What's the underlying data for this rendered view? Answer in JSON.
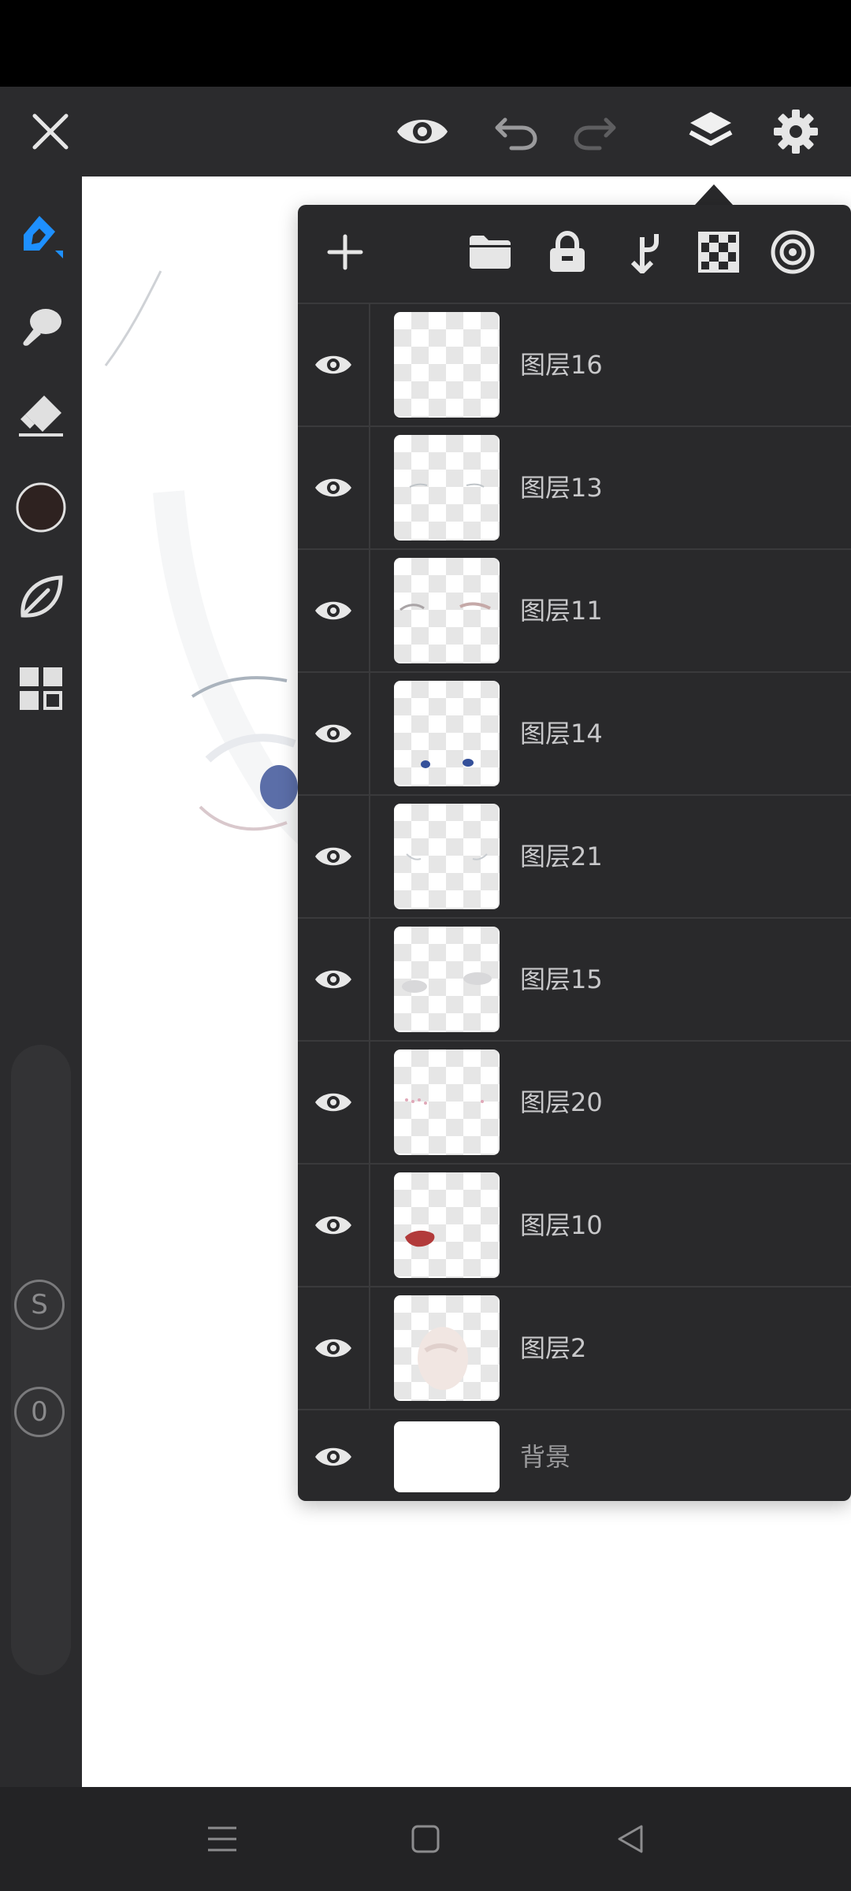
{
  "app": {
    "top_toolbar": {
      "close_icon": "close-icon",
      "preview_icon": "eye-icon",
      "undo_icon": "undo-icon",
      "redo_icon": "redo-icon",
      "layers_icon": "layers-icon",
      "settings_icon": "gear-icon"
    },
    "left_toolbar": {
      "tools": [
        "pen-icon",
        "smudge-icon",
        "eraser-icon",
        "color-swatch",
        "leaf-brush-icon",
        "grid-icon"
      ],
      "current_color": "#2e2220",
      "accent_color": "#1e90ff",
      "indicator_s": "S",
      "indicator_zero": "0"
    },
    "layers_panel": {
      "header_actions": [
        "add-icon",
        "folder-icon",
        "lock-icon",
        "merge-down-icon",
        "transparency-icon",
        "blend-icon"
      ],
      "layers": [
        {
          "name": "图层16",
          "visible": true
        },
        {
          "name": "图层13",
          "visible": true
        },
        {
          "name": "图层11",
          "visible": true
        },
        {
          "name": "图层14",
          "visible": true
        },
        {
          "name": "图层21",
          "visible": true
        },
        {
          "name": "图层15",
          "visible": true
        },
        {
          "name": "图层20",
          "visible": true
        },
        {
          "name": "图层10",
          "visible": true
        },
        {
          "name": "图层2",
          "visible": true
        }
      ],
      "background_layer": {
        "name": "背景",
        "visible": true
      }
    },
    "nav_bar": {
      "menu_icon": "menu-icon",
      "home_icon": "home-icon",
      "back_icon": "back-icon"
    }
  }
}
